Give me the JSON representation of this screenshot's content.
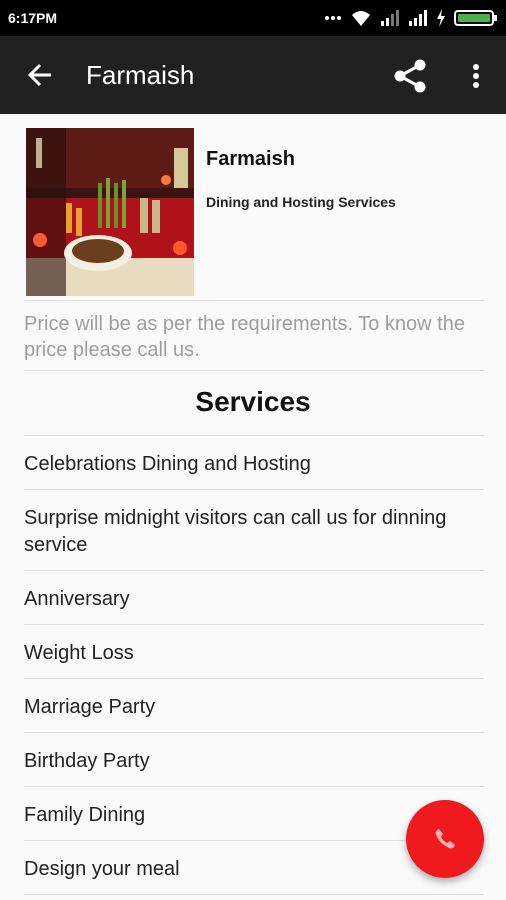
{
  "status_bar": {
    "time": "6:17PM"
  },
  "app_bar": {
    "title": "Farmaish",
    "icons": [
      "back-arrow-icon",
      "share-icon",
      "more-vert-icon"
    ]
  },
  "business": {
    "name": "Farmaish",
    "tagline": "Dining and Hosting Services",
    "price_note": "Price will be as per the requirements. To know the price please call us."
  },
  "services": {
    "title": "Services",
    "items": [
      "Celebrations Dining and Hosting",
      "Surprise midnight visitors can call us for dinning service",
      "Anniversary",
      "Weight Loss",
      "Marriage Party",
      "Birthday Party",
      "Family Dining",
      "Design your meal"
    ]
  },
  "fab": {
    "icon": "phone-icon",
    "color": "#f0191e"
  },
  "colors": {
    "app_bar": "#212121",
    "status_bar": "#000000",
    "muted_text": "#9e9e9e"
  }
}
